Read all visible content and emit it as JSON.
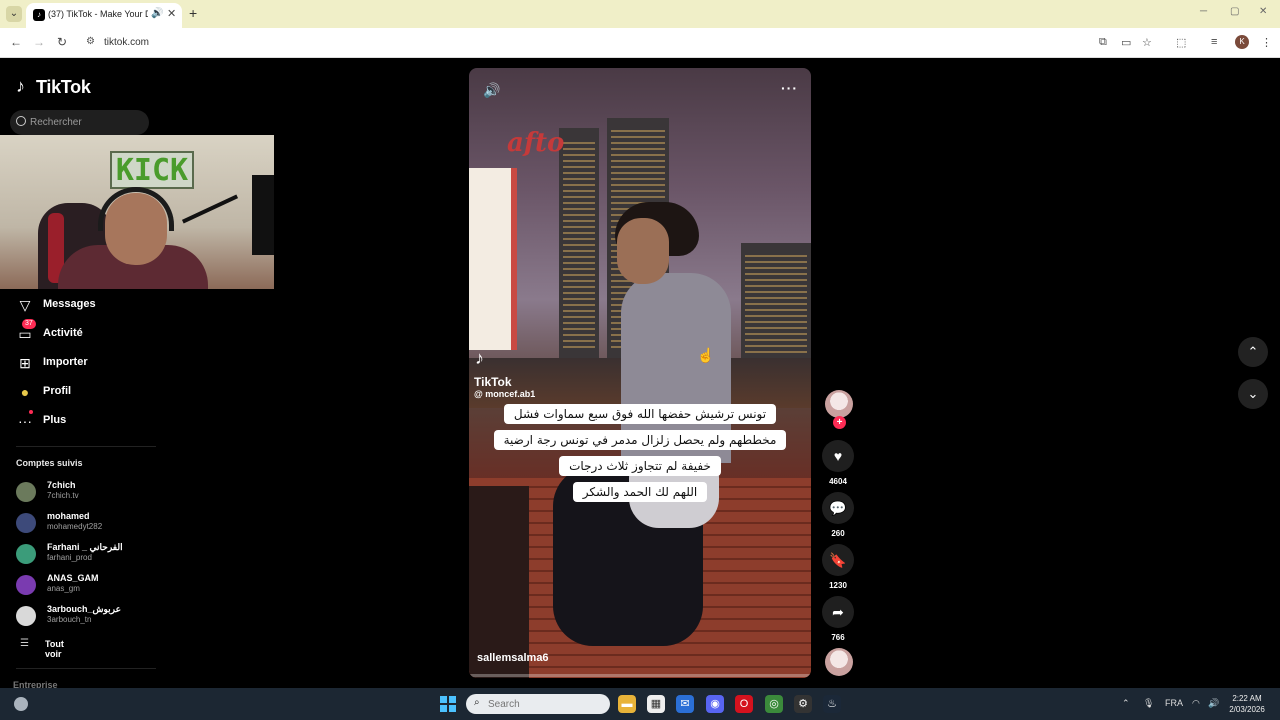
{
  "browser": {
    "tab_title": "(37) TikTok - Make Your Day",
    "url": "tiktok.com"
  },
  "sidebar": {
    "brand": "TikTok",
    "search_placeholder": "Rechercher",
    "nav": [
      {
        "label": "Messages",
        "icon": "paper-plane-icon"
      },
      {
        "label": "Activité",
        "icon": "inbox-icon",
        "badge": "37"
      },
      {
        "label": "Importer",
        "icon": "upload-icon"
      },
      {
        "label": "Profil",
        "icon": "avatar-icon"
      },
      {
        "label": "Plus",
        "icon": "more-icon"
      }
    ],
    "following_title": "Comptes suivis",
    "accounts": [
      {
        "name": "7chich",
        "handle": "7chich.tv",
        "color": "#6b7a5c"
      },
      {
        "name": "mohamed",
        "handle": "mohamedyt282",
        "color": "#3d4a7a"
      },
      {
        "name": "Farhani _ الفرحاني",
        "handle": "farhani_prod",
        "color": "#3b9c7a"
      },
      {
        "name": "ANAS_GAM",
        "handle": "anas_gm",
        "color": "#7a3bb0"
      },
      {
        "name": "3arbouch_عربوش",
        "handle": "3arbouch_tn",
        "color": "#d9d9d9"
      }
    ],
    "see_all": "Tout voir",
    "footer": "Entreprise"
  },
  "video": {
    "watermark_brand": "TikTok",
    "watermark_handle": "@ moncef.ab1",
    "caption_lines": [
      "تونس ترشيش حفضها الله فوق سبع سماوات فشل",
      "مخططهم ولم يحصل زلزال مدمر في تونس رجة ارضية",
      "خفيفة لم تتجاوز ثلاث درجات",
      "اللهم لك الحمد والشكر"
    ],
    "author": "sallemsalma6"
  },
  "actions": {
    "likes": "4604",
    "comments": "260",
    "saves": "1230",
    "shares": "766"
  },
  "taskbar": {
    "search_placeholder": "Search",
    "lang": "FRA",
    "time": "2:22 AM",
    "date": "2/03/2026"
  }
}
